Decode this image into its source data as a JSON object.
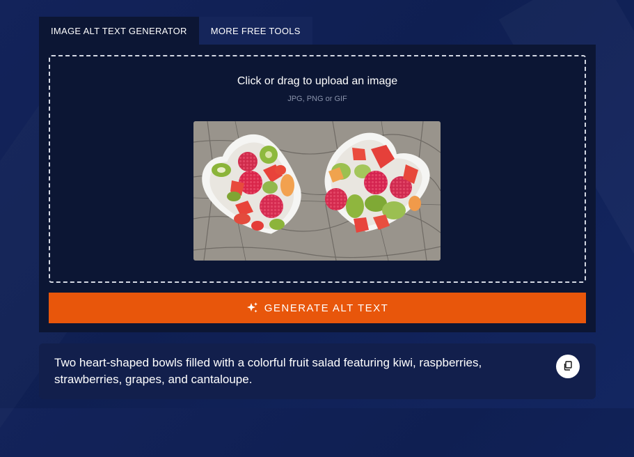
{
  "tabs": [
    {
      "label": "IMAGE ALT TEXT GENERATOR",
      "active": true
    },
    {
      "label": "MORE FREE TOOLS",
      "active": false
    }
  ],
  "upload": {
    "title": "Click or drag to upload an image",
    "formats": "JPG, PNG or GIF"
  },
  "generate_button": {
    "label": "GENERATE ALT TEXT",
    "icon": "sparkle-icon"
  },
  "result": {
    "text": "Two heart-shaped bowls filled with a colorful fruit salad featuring kiwi, raspberries, strawberries, grapes, and cantaloupe.",
    "copy_icon": "copy-icon"
  },
  "colors": {
    "background": "#13235a",
    "panel": "#0c1634",
    "accent": "#e8560b",
    "result_card": "#121f4c"
  }
}
